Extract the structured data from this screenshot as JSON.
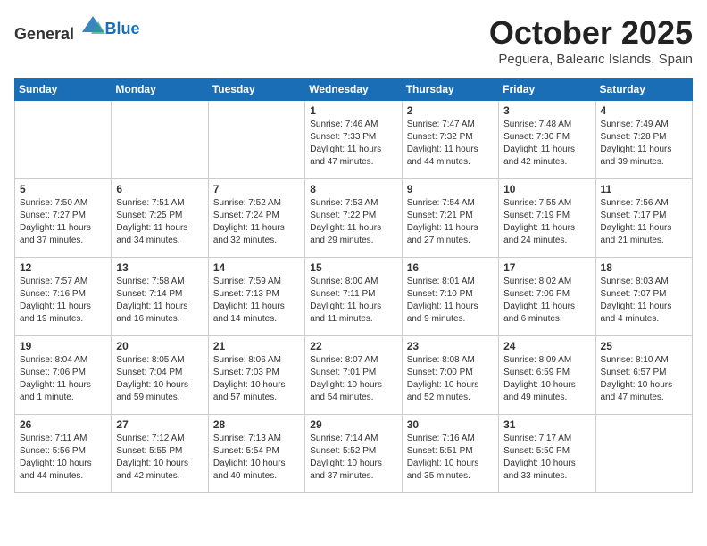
{
  "header": {
    "logo_general": "General",
    "logo_blue": "Blue",
    "month_title": "October 2025",
    "location": "Peguera, Balearic Islands, Spain"
  },
  "weekdays": [
    "Sunday",
    "Monday",
    "Tuesday",
    "Wednesday",
    "Thursday",
    "Friday",
    "Saturday"
  ],
  "weeks": [
    [
      {
        "day": "",
        "empty": true
      },
      {
        "day": "",
        "empty": true
      },
      {
        "day": "",
        "empty": true
      },
      {
        "day": "1",
        "sunrise": "7:46 AM",
        "sunset": "7:33 PM",
        "daylight": "11 hours and 47 minutes."
      },
      {
        "day": "2",
        "sunrise": "7:47 AM",
        "sunset": "7:32 PM",
        "daylight": "11 hours and 44 minutes."
      },
      {
        "day": "3",
        "sunrise": "7:48 AM",
        "sunset": "7:30 PM",
        "daylight": "11 hours and 42 minutes."
      },
      {
        "day": "4",
        "sunrise": "7:49 AM",
        "sunset": "7:28 PM",
        "daylight": "11 hours and 39 minutes."
      }
    ],
    [
      {
        "day": "5",
        "sunrise": "7:50 AM",
        "sunset": "7:27 PM",
        "daylight": "11 hours and 37 minutes."
      },
      {
        "day": "6",
        "sunrise": "7:51 AM",
        "sunset": "7:25 PM",
        "daylight": "11 hours and 34 minutes."
      },
      {
        "day": "7",
        "sunrise": "7:52 AM",
        "sunset": "7:24 PM",
        "daylight": "11 hours and 32 minutes."
      },
      {
        "day": "8",
        "sunrise": "7:53 AM",
        "sunset": "7:22 PM",
        "daylight": "11 hours and 29 minutes."
      },
      {
        "day": "9",
        "sunrise": "7:54 AM",
        "sunset": "7:21 PM",
        "daylight": "11 hours and 27 minutes."
      },
      {
        "day": "10",
        "sunrise": "7:55 AM",
        "sunset": "7:19 PM",
        "daylight": "11 hours and 24 minutes."
      },
      {
        "day": "11",
        "sunrise": "7:56 AM",
        "sunset": "7:17 PM",
        "daylight": "11 hours and 21 minutes."
      }
    ],
    [
      {
        "day": "12",
        "sunrise": "7:57 AM",
        "sunset": "7:16 PM",
        "daylight": "11 hours and 19 minutes."
      },
      {
        "day": "13",
        "sunrise": "7:58 AM",
        "sunset": "7:14 PM",
        "daylight": "11 hours and 16 minutes."
      },
      {
        "day": "14",
        "sunrise": "7:59 AM",
        "sunset": "7:13 PM",
        "daylight": "11 hours and 14 minutes."
      },
      {
        "day": "15",
        "sunrise": "8:00 AM",
        "sunset": "7:11 PM",
        "daylight": "11 hours and 11 minutes."
      },
      {
        "day": "16",
        "sunrise": "8:01 AM",
        "sunset": "7:10 PM",
        "daylight": "11 hours and 9 minutes."
      },
      {
        "day": "17",
        "sunrise": "8:02 AM",
        "sunset": "7:09 PM",
        "daylight": "11 hours and 6 minutes."
      },
      {
        "day": "18",
        "sunrise": "8:03 AM",
        "sunset": "7:07 PM",
        "daylight": "11 hours and 4 minutes."
      }
    ],
    [
      {
        "day": "19",
        "sunrise": "8:04 AM",
        "sunset": "7:06 PM",
        "daylight": "11 hours and 1 minute."
      },
      {
        "day": "20",
        "sunrise": "8:05 AM",
        "sunset": "7:04 PM",
        "daylight": "10 hours and 59 minutes."
      },
      {
        "day": "21",
        "sunrise": "8:06 AM",
        "sunset": "7:03 PM",
        "daylight": "10 hours and 57 minutes."
      },
      {
        "day": "22",
        "sunrise": "8:07 AM",
        "sunset": "7:01 PM",
        "daylight": "10 hours and 54 minutes."
      },
      {
        "day": "23",
        "sunrise": "8:08 AM",
        "sunset": "7:00 PM",
        "daylight": "10 hours and 52 minutes."
      },
      {
        "day": "24",
        "sunrise": "8:09 AM",
        "sunset": "6:59 PM",
        "daylight": "10 hours and 49 minutes."
      },
      {
        "day": "25",
        "sunrise": "8:10 AM",
        "sunset": "6:57 PM",
        "daylight": "10 hours and 47 minutes."
      }
    ],
    [
      {
        "day": "26",
        "sunrise": "7:11 AM",
        "sunset": "5:56 PM",
        "daylight": "10 hours and 44 minutes."
      },
      {
        "day": "27",
        "sunrise": "7:12 AM",
        "sunset": "5:55 PM",
        "daylight": "10 hours and 42 minutes."
      },
      {
        "day": "28",
        "sunrise": "7:13 AM",
        "sunset": "5:54 PM",
        "daylight": "10 hours and 40 minutes."
      },
      {
        "day": "29",
        "sunrise": "7:14 AM",
        "sunset": "5:52 PM",
        "daylight": "10 hours and 37 minutes."
      },
      {
        "day": "30",
        "sunrise": "7:16 AM",
        "sunset": "5:51 PM",
        "daylight": "10 hours and 35 minutes."
      },
      {
        "day": "31",
        "sunrise": "7:17 AM",
        "sunset": "5:50 PM",
        "daylight": "10 hours and 33 minutes."
      },
      {
        "day": "",
        "empty": true
      }
    ]
  ]
}
